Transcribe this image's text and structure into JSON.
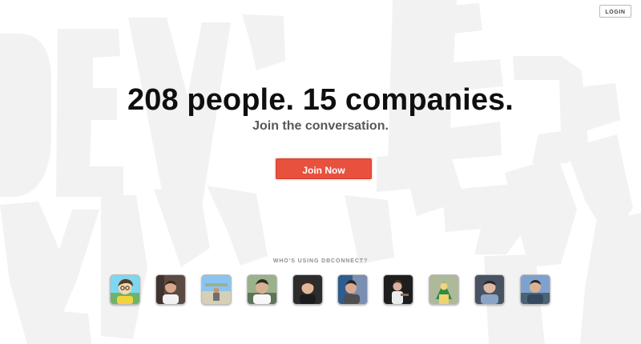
{
  "header": {
    "login_label": "LOGIN"
  },
  "hero": {
    "headline": "208 people. 15 companies.",
    "subheadline": "Join the conversation.",
    "join_button_label": "Join Now"
  },
  "users": {
    "title": "WHO'S USING DBCONNECT?"
  },
  "colors": {
    "accent": "#E8513E",
    "background": "#FFFFFF",
    "watermark": "#F2F2F2",
    "headline": "#0F0F0F",
    "subheadline": "#5B5656"
  }
}
